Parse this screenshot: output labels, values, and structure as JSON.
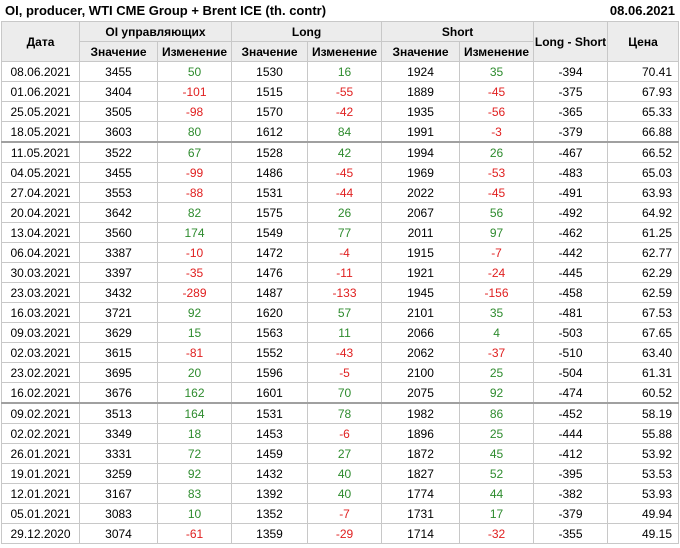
{
  "title": "OI, producer, WTI CME Group + Brent ICE (th. contr)",
  "date": "08.06.2021",
  "headers": {
    "date": "Дата",
    "oi": "OI управляющих",
    "long": "Long",
    "short": "Short",
    "long_short": "Long - Short",
    "price": "Цена",
    "value": "Значение",
    "change": "Изменение"
  },
  "colors": {
    "positive": "#2e8b2e",
    "negative": "#e02020"
  },
  "rows": [
    {
      "date": "08.06.2021",
      "oi": "3455",
      "oi_chg": "50",
      "long": "1530",
      "long_chg": "16",
      "short": "1924",
      "short_chg": "35",
      "ls": "-394",
      "price": "70.41"
    },
    {
      "date": "01.06.2021",
      "oi": "3404",
      "oi_chg": "-101",
      "long": "1515",
      "long_chg": "-55",
      "short": "1889",
      "short_chg": "-45",
      "ls": "-375",
      "price": "67.93"
    },
    {
      "date": "25.05.2021",
      "oi": "3505",
      "oi_chg": "-98",
      "long": "1570",
      "long_chg": "-42",
      "short": "1935",
      "short_chg": "-56",
      "ls": "-365",
      "price": "65.33"
    },
    {
      "date": "18.05.2021",
      "oi": "3603",
      "oi_chg": "80",
      "long": "1612",
      "long_chg": "84",
      "short": "1991",
      "short_chg": "-3",
      "ls": "-379",
      "price": "66.88"
    },
    {
      "date": "11.05.2021",
      "oi": "3522",
      "oi_chg": "67",
      "long": "1528",
      "long_chg": "42",
      "short": "1994",
      "short_chg": "26",
      "ls": "-467",
      "price": "66.52"
    },
    {
      "date": "04.05.2021",
      "oi": "3455",
      "oi_chg": "-99",
      "long": "1486",
      "long_chg": "-45",
      "short": "1969",
      "short_chg": "-53",
      "ls": "-483",
      "price": "65.03"
    },
    {
      "date": "27.04.2021",
      "oi": "3553",
      "oi_chg": "-88",
      "long": "1531",
      "long_chg": "-44",
      "short": "2022",
      "short_chg": "-45",
      "ls": "-491",
      "price": "63.93"
    },
    {
      "date": "20.04.2021",
      "oi": "3642",
      "oi_chg": "82",
      "long": "1575",
      "long_chg": "26",
      "short": "2067",
      "short_chg": "56",
      "ls": "-492",
      "price": "64.92"
    },
    {
      "date": "13.04.2021",
      "oi": "3560",
      "oi_chg": "174",
      "long": "1549",
      "long_chg": "77",
      "short": "2011",
      "short_chg": "97",
      "ls": "-462",
      "price": "61.25"
    },
    {
      "date": "06.04.2021",
      "oi": "3387",
      "oi_chg": "-10",
      "long": "1472",
      "long_chg": "-4",
      "short": "1915",
      "short_chg": "-7",
      "ls": "-442",
      "price": "62.77"
    },
    {
      "date": "30.03.2021",
      "oi": "3397",
      "oi_chg": "-35",
      "long": "1476",
      "long_chg": "-11",
      "short": "1921",
      "short_chg": "-24",
      "ls": "-445",
      "price": "62.29"
    },
    {
      "date": "23.03.2021",
      "oi": "3432",
      "oi_chg": "-289",
      "long": "1487",
      "long_chg": "-133",
      "short": "1945",
      "short_chg": "-156",
      "ls": "-458",
      "price": "62.59"
    },
    {
      "date": "16.03.2021",
      "oi": "3721",
      "oi_chg": "92",
      "long": "1620",
      "long_chg": "57",
      "short": "2101",
      "short_chg": "35",
      "ls": "-481",
      "price": "67.53"
    },
    {
      "date": "09.03.2021",
      "oi": "3629",
      "oi_chg": "15",
      "long": "1563",
      "long_chg": "11",
      "short": "2066",
      "short_chg": "4",
      "ls": "-503",
      "price": "67.65"
    },
    {
      "date": "02.03.2021",
      "oi": "3615",
      "oi_chg": "-81",
      "long": "1552",
      "long_chg": "-43",
      "short": "2062",
      "short_chg": "-37",
      "ls": "-510",
      "price": "63.40"
    },
    {
      "date": "23.02.2021",
      "oi": "3695",
      "oi_chg": "20",
      "long": "1596",
      "long_chg": "-5",
      "short": "2100",
      "short_chg": "25",
      "ls": "-504",
      "price": "61.31"
    },
    {
      "date": "16.02.2021",
      "oi": "3676",
      "oi_chg": "162",
      "long": "1601",
      "long_chg": "70",
      "short": "2075",
      "short_chg": "92",
      "ls": "-474",
      "price": "60.52"
    },
    {
      "date": "09.02.2021",
      "oi": "3513",
      "oi_chg": "164",
      "long": "1531",
      "long_chg": "78",
      "short": "1982",
      "short_chg": "86",
      "ls": "-452",
      "price": "58.19"
    },
    {
      "date": "02.02.2021",
      "oi": "3349",
      "oi_chg": "18",
      "long": "1453",
      "long_chg": "-6",
      "short": "1896",
      "short_chg": "25",
      "ls": "-444",
      "price": "55.88"
    },
    {
      "date": "26.01.2021",
      "oi": "3331",
      "oi_chg": "72",
      "long": "1459",
      "long_chg": "27",
      "short": "1872",
      "short_chg": "45",
      "ls": "-412",
      "price": "53.92"
    },
    {
      "date": "19.01.2021",
      "oi": "3259",
      "oi_chg": "92",
      "long": "1432",
      "long_chg": "40",
      "short": "1827",
      "short_chg": "52",
      "ls": "-395",
      "price": "53.53"
    },
    {
      "date": "12.01.2021",
      "oi": "3167",
      "oi_chg": "83",
      "long": "1392",
      "long_chg": "40",
      "short": "1774",
      "short_chg": "44",
      "ls": "-382",
      "price": "53.93"
    },
    {
      "date": "05.01.2021",
      "oi": "3083",
      "oi_chg": "10",
      "long": "1352",
      "long_chg": "-7",
      "short": "1731",
      "short_chg": "17",
      "ls": "-379",
      "price": "49.94"
    },
    {
      "date": "29.12.2020",
      "oi": "3074",
      "oi_chg": "-61",
      "long": "1359",
      "long_chg": "-29",
      "short": "1714",
      "short_chg": "-32",
      "ls": "-355",
      "price": "49.15"
    }
  ]
}
